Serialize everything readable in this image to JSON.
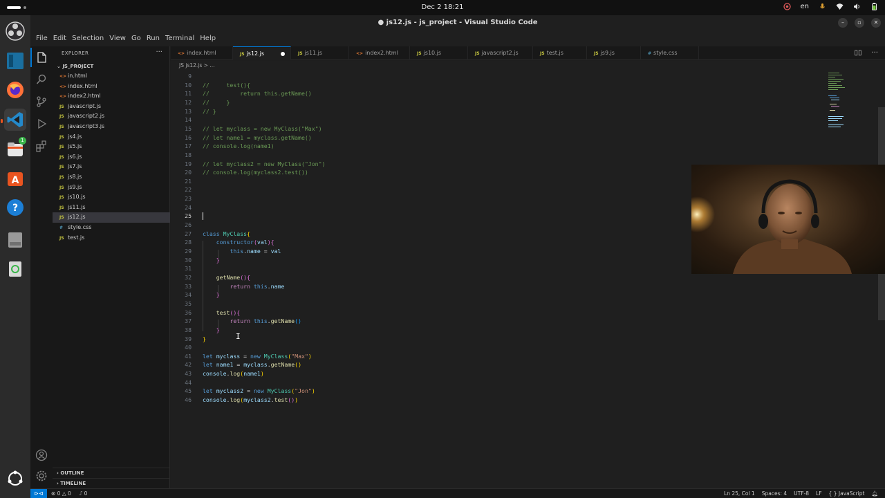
{
  "os": {
    "clock": "Dec 2  18:21",
    "tray": {
      "lang": "en"
    }
  },
  "window": {
    "title": "● js12.js - js_project - Visual Studio Code",
    "colors": {
      "accent": "#0078d4",
      "ubuntu_orange": "#e95420"
    }
  },
  "menu": [
    "File",
    "Edit",
    "Selection",
    "View",
    "Go",
    "Run",
    "Terminal",
    "Help"
  ],
  "sidebar": {
    "header": "EXPLORER",
    "more": "···",
    "project": "JS_PROJECT",
    "files": [
      {
        "icon": "html",
        "icon_text": "<>",
        "name": "in.html"
      },
      {
        "icon": "html",
        "icon_text": "<>",
        "name": "index.html"
      },
      {
        "icon": "html",
        "icon_text": "<>",
        "name": "index2.html"
      },
      {
        "icon": "js",
        "icon_text": "JS",
        "name": "javascript.js"
      },
      {
        "icon": "js",
        "icon_text": "JS",
        "name": "javascript2.js"
      },
      {
        "icon": "js",
        "icon_text": "JS",
        "name": "javascript3.js"
      },
      {
        "icon": "js",
        "icon_text": "JS",
        "name": "js4.js"
      },
      {
        "icon": "js",
        "icon_text": "JS",
        "name": "js5.js"
      },
      {
        "icon": "js",
        "icon_text": "JS",
        "name": "js6.js"
      },
      {
        "icon": "js",
        "icon_text": "JS",
        "name": "js7.js"
      },
      {
        "icon": "js",
        "icon_text": "JS",
        "name": "js8.js"
      },
      {
        "icon": "js",
        "icon_text": "JS",
        "name": "js9.js"
      },
      {
        "icon": "js",
        "icon_text": "JS",
        "name": "js10.js"
      },
      {
        "icon": "js",
        "icon_text": "JS",
        "name": "js11.js"
      },
      {
        "icon": "js",
        "icon_text": "JS",
        "name": "js12.js",
        "selected": true
      },
      {
        "icon": "css",
        "icon_text": "#",
        "name": "style.css"
      },
      {
        "icon": "js",
        "icon_text": "JS",
        "name": "test.js"
      }
    ],
    "outline": "OUTLINE",
    "timeline": "TIMELINE"
  },
  "tabs": [
    {
      "icon": "html",
      "icon_text": "<>",
      "name": "index.html"
    },
    {
      "icon": "js",
      "icon_text": "JS",
      "name": "js12.js",
      "active": true,
      "modified": true
    },
    {
      "icon": "js",
      "icon_text": "JS",
      "name": "js11.js"
    },
    {
      "icon": "html",
      "icon_text": "<>",
      "name": "index2.html"
    },
    {
      "icon": "js",
      "icon_text": "JS",
      "name": "js10.js"
    },
    {
      "icon": "js",
      "icon_text": "JS",
      "name": "javascript2.js"
    },
    {
      "icon": "js",
      "icon_text": "JS",
      "name": "test.js"
    },
    {
      "icon": "js",
      "icon_text": "JS",
      "name": "js9.js"
    },
    {
      "icon": "css",
      "icon_text": "#",
      "name": "style.css"
    }
  ],
  "breadcrumb": "JS js12.js > ...",
  "editor": {
    "current_line": 25,
    "lines": [
      {
        "n": 9,
        "tokens": []
      },
      {
        "n": 10,
        "tokens": [
          [
            "c-com",
            "//     test(){"
          ]
        ]
      },
      {
        "n": 11,
        "tokens": [
          [
            "c-com",
            "//         return this.getName()"
          ]
        ]
      },
      {
        "n": 12,
        "tokens": [
          [
            "c-com",
            "//     }"
          ]
        ]
      },
      {
        "n": 13,
        "tokens": [
          [
            "c-com",
            "// }"
          ]
        ]
      },
      {
        "n": 14,
        "tokens": []
      },
      {
        "n": 15,
        "tokens": [
          [
            "c-com",
            "// let myclass = new MyClass(\"Max\")"
          ]
        ]
      },
      {
        "n": 16,
        "tokens": [
          [
            "c-com",
            "// let name1 = myclass.getName()"
          ]
        ]
      },
      {
        "n": 17,
        "tokens": [
          [
            "c-com",
            "// console.log(name1)"
          ]
        ]
      },
      {
        "n": 18,
        "tokens": []
      },
      {
        "n": 19,
        "tokens": [
          [
            "c-com",
            "// let myclass2 = new MyClass(\"Jon\")"
          ]
        ]
      },
      {
        "n": 20,
        "tokens": [
          [
            "c-com",
            "// console.log(myclass2.test())"
          ]
        ]
      },
      {
        "n": 21,
        "tokens": []
      },
      {
        "n": 22,
        "tokens": []
      },
      {
        "n": 23,
        "tokens": []
      },
      {
        "n": 24,
        "tokens": []
      },
      {
        "n": 25,
        "tokens": []
      },
      {
        "n": 26,
        "tokens": []
      },
      {
        "n": 27,
        "tokens": [
          [
            "c-kw",
            "class"
          ],
          [
            "",
            " "
          ],
          [
            "c-cls",
            "MyClass"
          ],
          [
            "c-br1",
            "{"
          ]
        ]
      },
      {
        "n": 28,
        "tokens": [
          [
            "",
            "    "
          ],
          [
            "c-kw",
            "constructor"
          ],
          [
            "c-br2",
            "("
          ],
          [
            "c-var",
            "val"
          ],
          [
            "c-br2",
            "){"
          ]
        ]
      },
      {
        "n": 29,
        "tokens": [
          [
            "",
            "        "
          ],
          [
            "c-kw",
            "this"
          ],
          [
            "",
            "."
          ],
          [
            "c-var",
            "name"
          ],
          [
            "",
            " = "
          ],
          [
            "c-var",
            "val"
          ]
        ]
      },
      {
        "n": 30,
        "tokens": [
          [
            "",
            "    "
          ],
          [
            "c-br2",
            "}"
          ]
        ]
      },
      {
        "n": 31,
        "tokens": []
      },
      {
        "n": 32,
        "tokens": [
          [
            "",
            "    "
          ],
          [
            "c-fn",
            "getName"
          ],
          [
            "c-br2",
            "(){"
          ]
        ]
      },
      {
        "n": 33,
        "tokens": [
          [
            "",
            "        "
          ],
          [
            "c-ctl",
            "return"
          ],
          [
            "",
            " "
          ],
          [
            "c-kw",
            "this"
          ],
          [
            "",
            "."
          ],
          [
            "c-var",
            "name"
          ]
        ]
      },
      {
        "n": 34,
        "tokens": [
          [
            "",
            "    "
          ],
          [
            "c-br2",
            "}"
          ]
        ]
      },
      {
        "n": 35,
        "tokens": []
      },
      {
        "n": 36,
        "tokens": [
          [
            "",
            "    "
          ],
          [
            "c-fn",
            "test"
          ],
          [
            "c-br2",
            "(){"
          ]
        ]
      },
      {
        "n": 37,
        "tokens": [
          [
            "",
            "        "
          ],
          [
            "c-ctl",
            "return"
          ],
          [
            "",
            " "
          ],
          [
            "c-kw",
            "this"
          ],
          [
            "",
            "."
          ],
          [
            "c-fn",
            "getName"
          ],
          [
            "c-br3",
            "()"
          ]
        ]
      },
      {
        "n": 38,
        "tokens": [
          [
            "",
            "    "
          ],
          [
            "c-br2",
            "}"
          ]
        ]
      },
      {
        "n": 39,
        "tokens": [
          [
            "c-br1",
            "}"
          ]
        ]
      },
      {
        "n": 40,
        "tokens": []
      },
      {
        "n": 41,
        "tokens": [
          [
            "c-kw",
            "let"
          ],
          [
            "",
            " "
          ],
          [
            "c-var",
            "myclass"
          ],
          [
            "",
            " = "
          ],
          [
            "c-kw",
            "new"
          ],
          [
            "",
            " "
          ],
          [
            "c-cls",
            "MyClass"
          ],
          [
            "c-br1",
            "("
          ],
          [
            "c-str",
            "\"Max\""
          ],
          [
            "c-br1",
            ")"
          ]
        ]
      },
      {
        "n": 42,
        "tokens": [
          [
            "c-kw",
            "let"
          ],
          [
            "",
            " "
          ],
          [
            "c-var",
            "name1"
          ],
          [
            "",
            " = "
          ],
          [
            "c-var",
            "myclass"
          ],
          [
            "",
            "."
          ],
          [
            "c-fn",
            "getName"
          ],
          [
            "c-br1",
            "()"
          ]
        ]
      },
      {
        "n": 43,
        "tokens": [
          [
            "c-var",
            "console"
          ],
          [
            "",
            "."
          ],
          [
            "c-fn",
            "log"
          ],
          [
            "c-br1",
            "("
          ],
          [
            "c-var",
            "name1"
          ],
          [
            "c-br1",
            ")"
          ]
        ]
      },
      {
        "n": 44,
        "tokens": []
      },
      {
        "n": 45,
        "tokens": [
          [
            "c-kw",
            "let"
          ],
          [
            "",
            " "
          ],
          [
            "c-var",
            "myclass2"
          ],
          [
            "",
            " = "
          ],
          [
            "c-kw",
            "new"
          ],
          [
            "",
            " "
          ],
          [
            "c-cls",
            "MyClass"
          ],
          [
            "c-br1",
            "("
          ],
          [
            "c-str",
            "\"Jon\""
          ],
          [
            "c-br1",
            ")"
          ]
        ]
      },
      {
        "n": 46,
        "tokens": [
          [
            "c-var",
            "console"
          ],
          [
            "",
            "."
          ],
          [
            "c-fn",
            "log"
          ],
          [
            "c-br1",
            "("
          ],
          [
            "c-var",
            "myclass2"
          ],
          [
            "",
            "."
          ],
          [
            "c-fn",
            "test"
          ],
          [
            "c-br2",
            "()"
          ],
          [
            "c-br1",
            ")"
          ]
        ]
      }
    ]
  },
  "statusbar": {
    "remote": "⊳⊲",
    "problems": "⊗ 0 △ 0",
    "ports": "⑀ 0",
    "position": "Ln 25, Col 1",
    "spaces": "Spaces: 4",
    "encoding": "UTF-8",
    "eol": "LF",
    "language": "{ } JavaScript"
  }
}
